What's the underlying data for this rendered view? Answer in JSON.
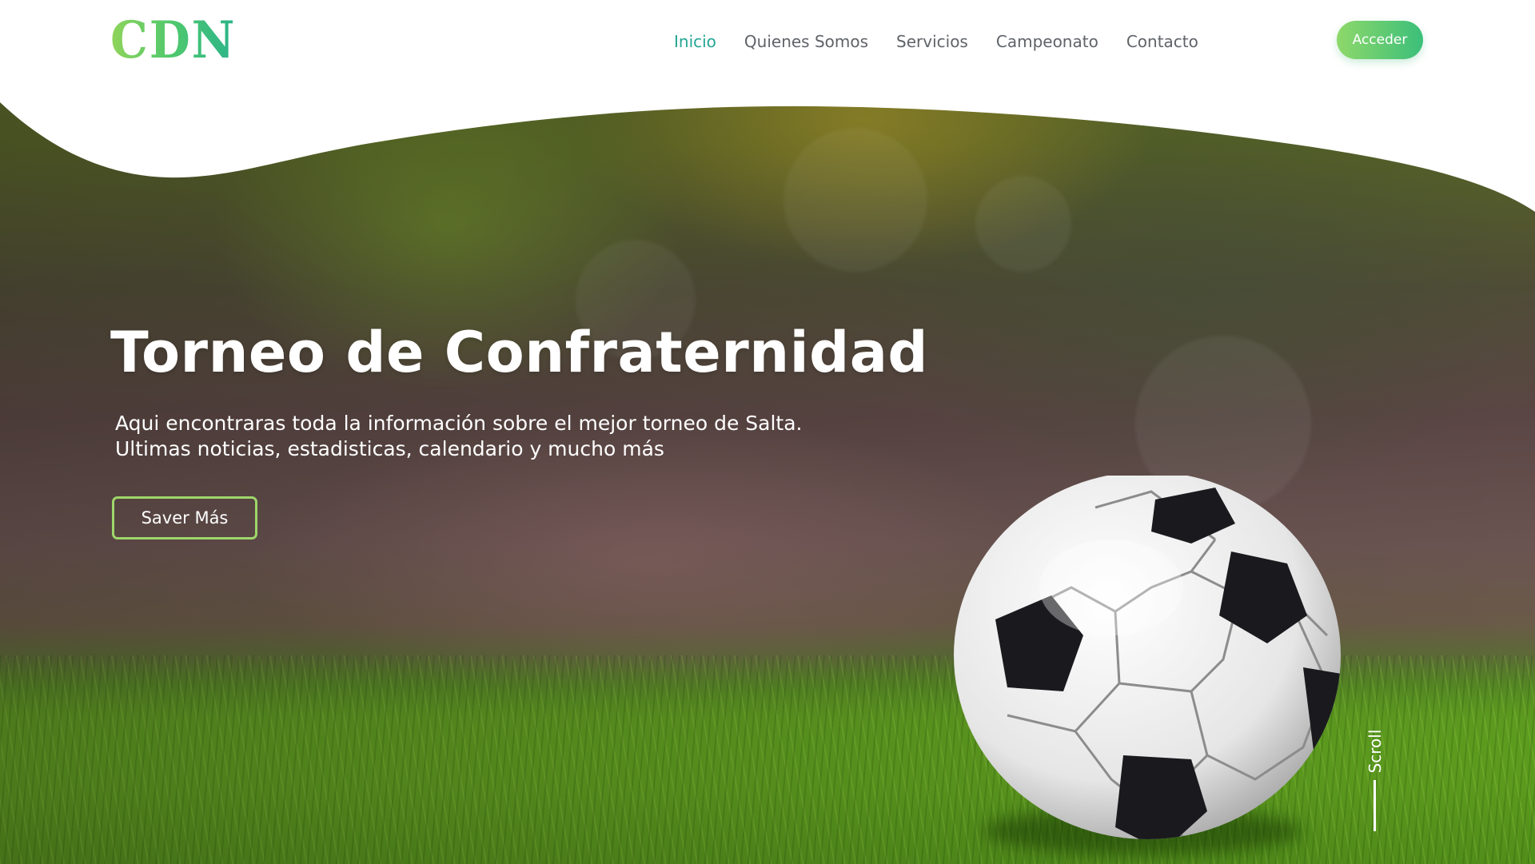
{
  "brand": {
    "logo_text": "CDN",
    "accent_gradient": [
      "#8fd45a",
      "#2bb48a"
    ]
  },
  "nav": {
    "items": [
      {
        "label": "Inicio",
        "active": true
      },
      {
        "label": "Quienes Somos",
        "active": false
      },
      {
        "label": "Servicios",
        "active": false
      },
      {
        "label": "Campeonato",
        "active": false
      },
      {
        "label": "Contacto",
        "active": false
      }
    ],
    "active_color": "#24a593",
    "login_label": "Acceder"
  },
  "hero": {
    "title": "Torneo de Confraternidad",
    "subtitle_line1": "Aqui encontraras toda la información sobre el mejor torneo de Salta.",
    "subtitle_line2": "Ultimas noticias, estadisticas, calendario y mucho más",
    "cta_label": "Saver Más",
    "cta_border_color": "#9ed66a",
    "background_image": "soccer-ball-on-grass"
  },
  "scroll_indicator": {
    "label": "Scroll"
  }
}
